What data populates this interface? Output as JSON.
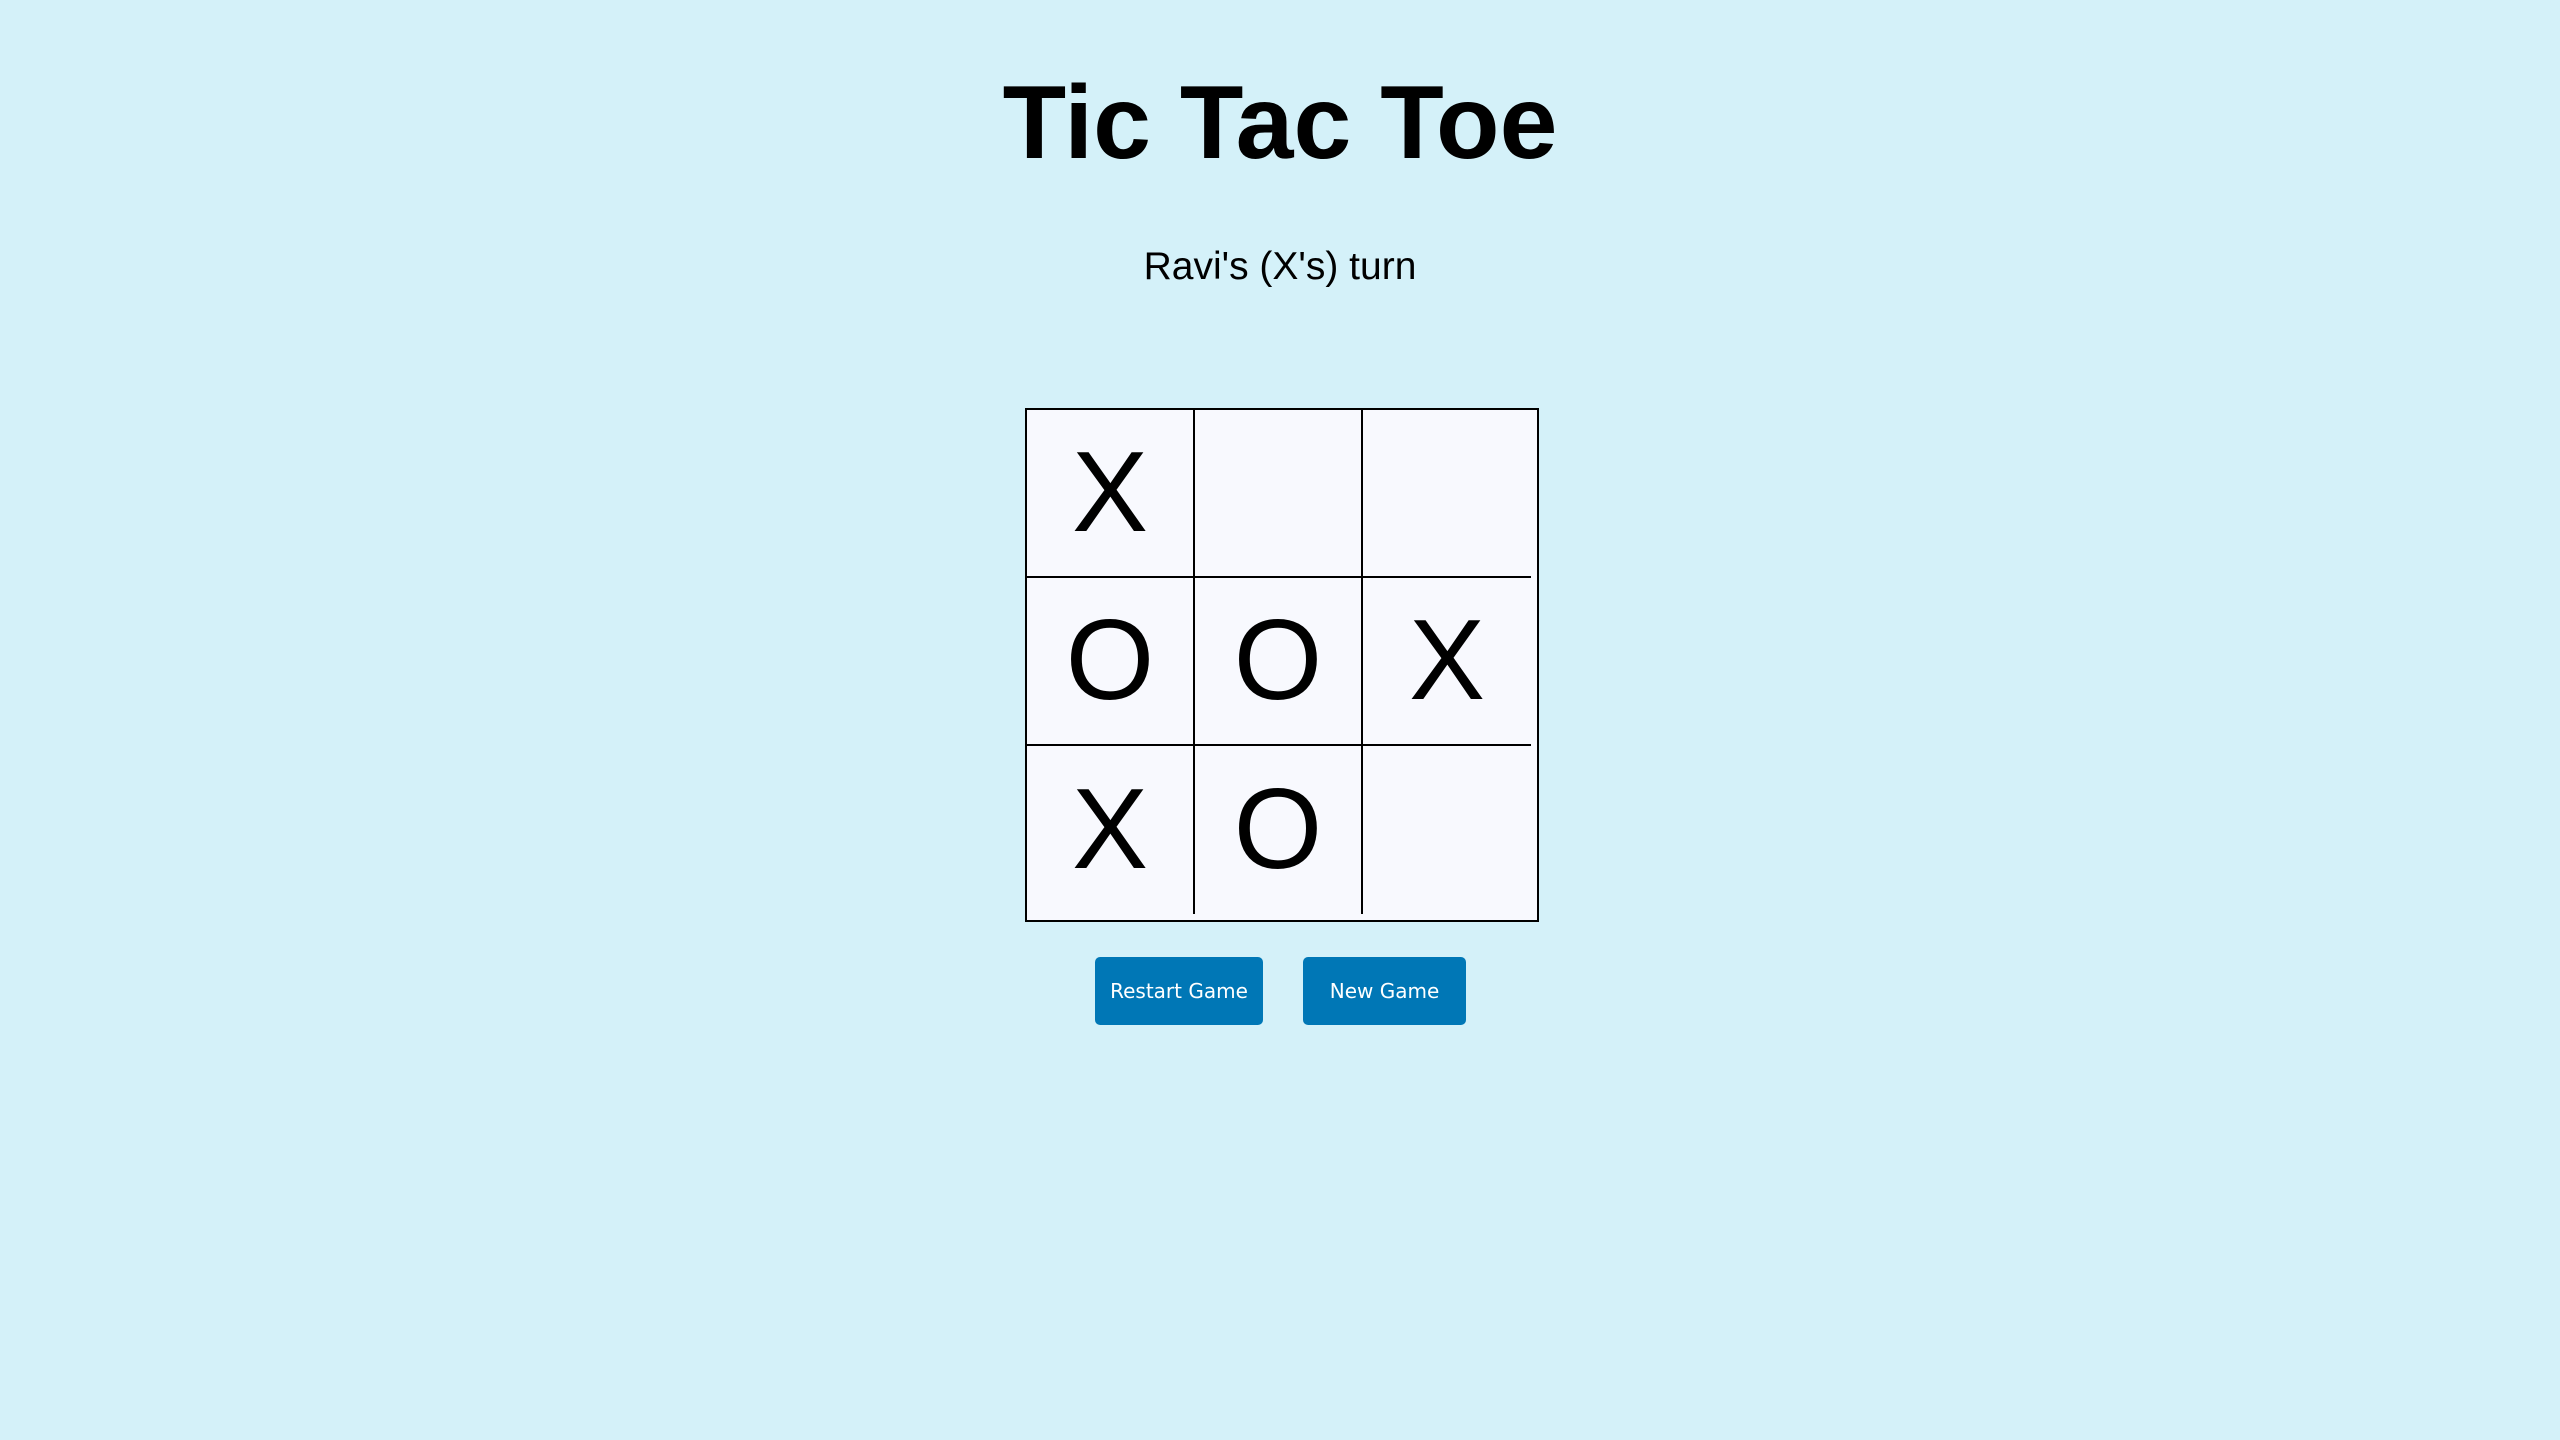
{
  "title": "Tic Tac Toe",
  "status": "Ravi's (X's) turn",
  "board": [
    [
      "X",
      "",
      ""
    ],
    [
      "O",
      "O",
      "X"
    ],
    [
      "X",
      "O",
      ""
    ]
  ],
  "buttons": {
    "restart_label": "Restart Game",
    "new_game_label": "New Game"
  },
  "colors": {
    "background": "#d4f1f9",
    "cell_background": "#f8f9fe",
    "button": "#0077b6",
    "button_text": "#ffffff"
  }
}
